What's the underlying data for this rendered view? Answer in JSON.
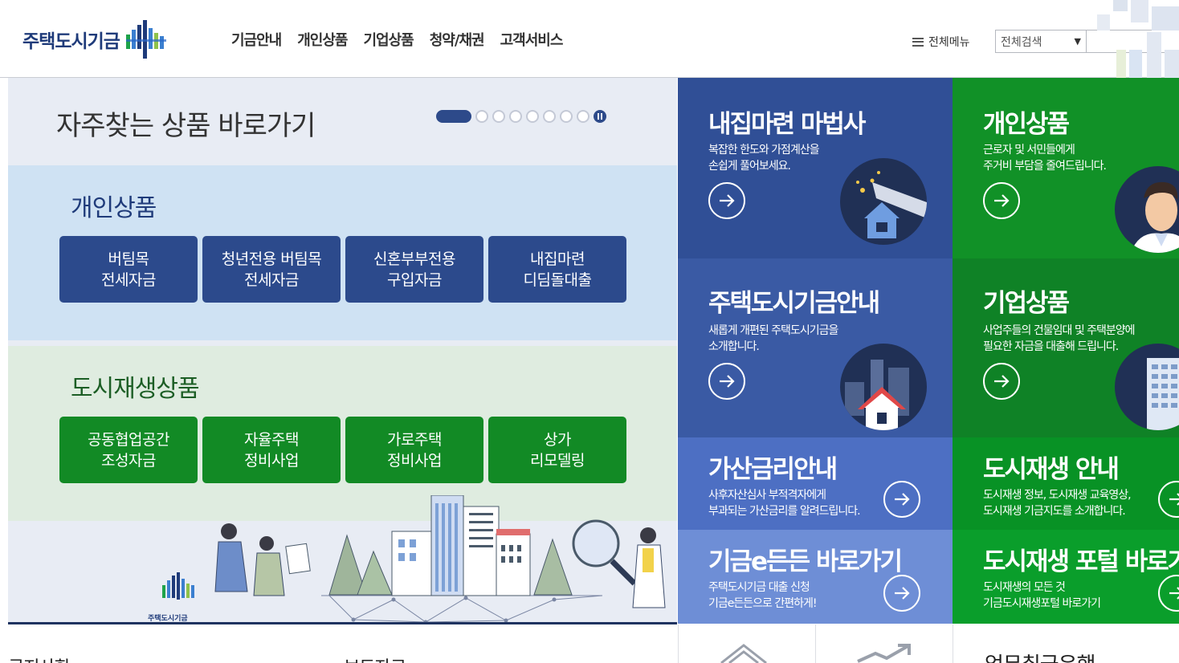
{
  "header": {
    "logo_text": "주택도시기금",
    "nav": [
      "기금안내",
      "개인상품",
      "기업상품",
      "청약/채권",
      "고객서비스"
    ],
    "all_menu_label": "전체메뉴",
    "search_scope": "전체검색",
    "search_value": ""
  },
  "quick": {
    "title": "자주찾는 상품 바로가기",
    "personal": {
      "title": "개인상품",
      "items": [
        "버팀목\n전세자금",
        "청년전용 버팀목\n전세자금",
        "신혼부부전용\n구입자금",
        "내집마련\n디딤돌대출"
      ]
    },
    "urban": {
      "title": "도시재생상품",
      "items": [
        "공동협업공간\n조성자금",
        "자율주택\n정비사업",
        "가로주택\n정비사업",
        "상가\n리모델링"
      ]
    },
    "illust_logo_text": "주택도시기금"
  },
  "tiles": {
    "wizard": {
      "title": "내집마련 마법사",
      "desc": "복잡한 한도와 가점계산을\n손쉽게 풀어보세요."
    },
    "personal": {
      "title": "개인상품",
      "desc": "근로자 및 서민들에게\n주거비 부담을 줄여드립니다."
    },
    "guide": {
      "title": "주택도시기금안내",
      "desc": "새롭게 개편된 주택도시기금을\n소개합니다."
    },
    "business": {
      "title": "기업상품",
      "desc": "사업주들의 건물임대 및 주택분양에\n필요한 자금을 대출해 드립니다."
    },
    "rate": {
      "title": "가산금리안내",
      "desc": "사후자산심사 부적격자에게\n부과되는 가산금리를 알려드립니다."
    },
    "urban": {
      "title": "도시재생 안내",
      "desc": "도시재생 정보, 도시재생 교육영상,\n도시재생 기금지도를 소개합니다."
    },
    "egov": {
      "title": "기금e든든 바로가기",
      "desc": "주택도시기금 대출 신청\n기금e든든으로 간편하게!"
    },
    "portal": {
      "title": "도시재생 포털 바로가기",
      "desc": "도시재생의 모든 것\n기금도시재생포털 바로가기"
    }
  },
  "bottom": {
    "left_label": "공지사항",
    "mid_label": "보도자료",
    "right_label": "업무취급은행"
  },
  "colors": {
    "navy": "#2c4a8c",
    "green": "#128a25",
    "tile_blue": "#304f96",
    "tile_green": "#119127"
  }
}
